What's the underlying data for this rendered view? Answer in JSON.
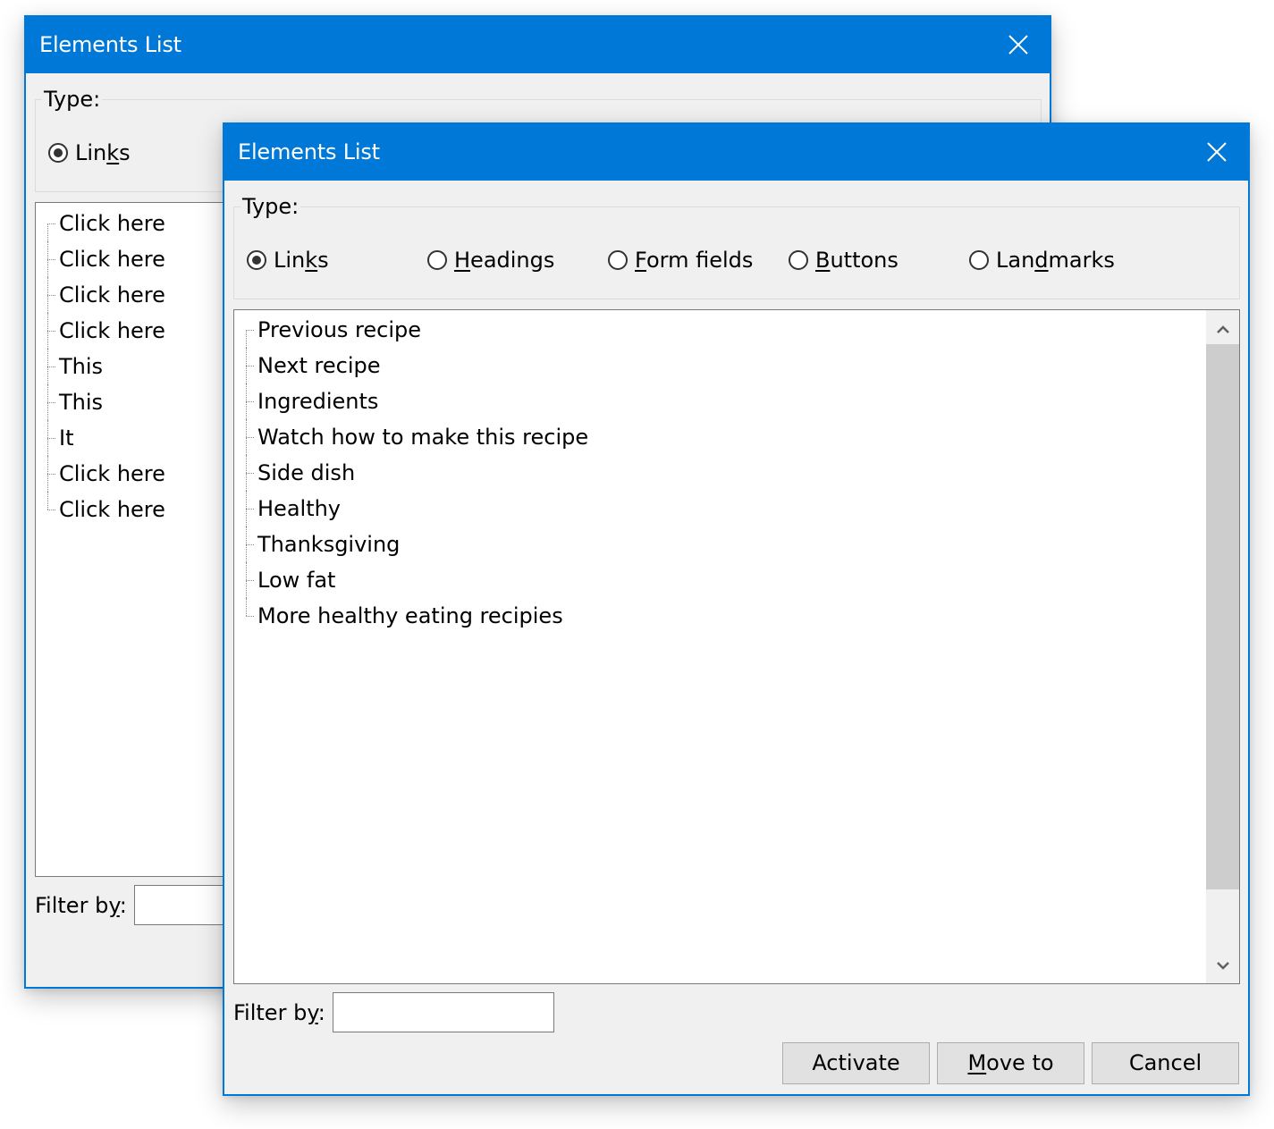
{
  "back_window": {
    "title": "Elements List",
    "type_label": "Type:",
    "radios": [
      {
        "label_pre": "Lin",
        "accel": "k",
        "label_post": "s",
        "checked": true
      }
    ],
    "items": [
      "Click here",
      "Click here",
      "Click here",
      "Click here",
      "This",
      "This",
      "It",
      "Click here",
      "Click here"
    ],
    "filter_label_pre": "Filter b",
    "filter_label_accel": "y",
    "filter_label_post": ":",
    "filter_value": ""
  },
  "front_window": {
    "title": "Elements List",
    "type_label": "Type:",
    "radios": [
      {
        "label_pre": "Lin",
        "accel": "k",
        "label_post": "s",
        "checked": true
      },
      {
        "label_pre": "",
        "accel": "H",
        "label_post": "eadings",
        "checked": false
      },
      {
        "label_pre": "",
        "accel": "F",
        "label_post": "orm fields",
        "checked": false
      },
      {
        "label_pre": "",
        "accel": "B",
        "label_post": "uttons",
        "checked": false
      },
      {
        "label_pre": "Lan",
        "accel": "d",
        "label_post": "marks",
        "checked": false
      }
    ],
    "items": [
      "Previous recipe",
      "Next recipe",
      "Ingredients",
      "Watch how to make this recipe",
      "Side dish",
      "Healthy",
      "Thanksgiving",
      "Low fat",
      "More healthy eating recipies"
    ],
    "filter_label_pre": "Filter b",
    "filter_label_accel": "y",
    "filter_label_post": ":",
    "filter_value": "",
    "buttons": {
      "activate": "Activate",
      "move_to_accel": "M",
      "move_to_rest": "ove to",
      "cancel": "Cancel"
    }
  },
  "colors": {
    "accent": "#0078d7",
    "window_bg": "#f0f0f0",
    "button_bg": "#e1e1e1",
    "scroll_thumb": "#cdcdcd"
  }
}
